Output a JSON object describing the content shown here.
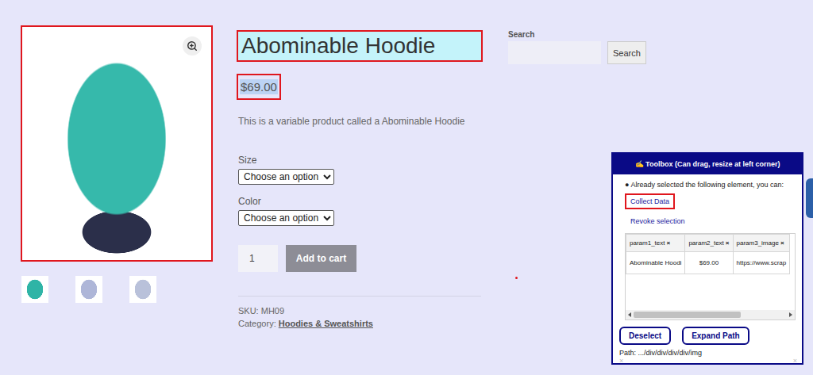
{
  "product": {
    "image": {
      "selected": true
    },
    "thumbnails": [
      {
        "color": "#2fb4a6"
      },
      {
        "color": "#aeb6d8"
      },
      {
        "color": "#b9c1da"
      }
    ],
    "title": {
      "text": "Abominable Hoodie",
      "selected": true
    },
    "price": {
      "text": "$69.00",
      "selected": true
    },
    "description": "This is a variable product called a Abominable Hoodie",
    "options": [
      {
        "label": "Size",
        "value": "Choose an option"
      },
      {
        "label": "Color",
        "value": "Choose an option"
      }
    ],
    "quantity": "1",
    "add_to_cart": "Add to cart",
    "sku_label": "SKU:",
    "sku": "MH09",
    "category_label": "Category:",
    "category": "Hoodies & Sweatshirts"
  },
  "search": {
    "label": "Search",
    "button": "Search"
  },
  "toolbox": {
    "title": "✍️ Toolbox (Can drag, resize at left corner)",
    "message": "● Already selected the following element, you can:",
    "actions": [
      {
        "label": "Collect Data",
        "selected": true
      },
      {
        "label": "Revoke selection",
        "selected": false
      }
    ],
    "table": {
      "columns": [
        {
          "label": "param1_text",
          "remove": "×"
        },
        {
          "label": "param2_text",
          "remove": "×"
        },
        {
          "label": "param3_image",
          "remove": "×"
        }
      ],
      "rows": [
        [
          "Abominable Hoodi",
          "$69.00",
          "https://www.scrap"
        ]
      ]
    },
    "scroll": {
      "level": 0.7
    },
    "buttons": [
      "Deselect",
      "Expand Path"
    ],
    "path": "Path: .../div/div/div/div/img",
    "corner_marks": [
      "×",
      "×"
    ]
  }
}
